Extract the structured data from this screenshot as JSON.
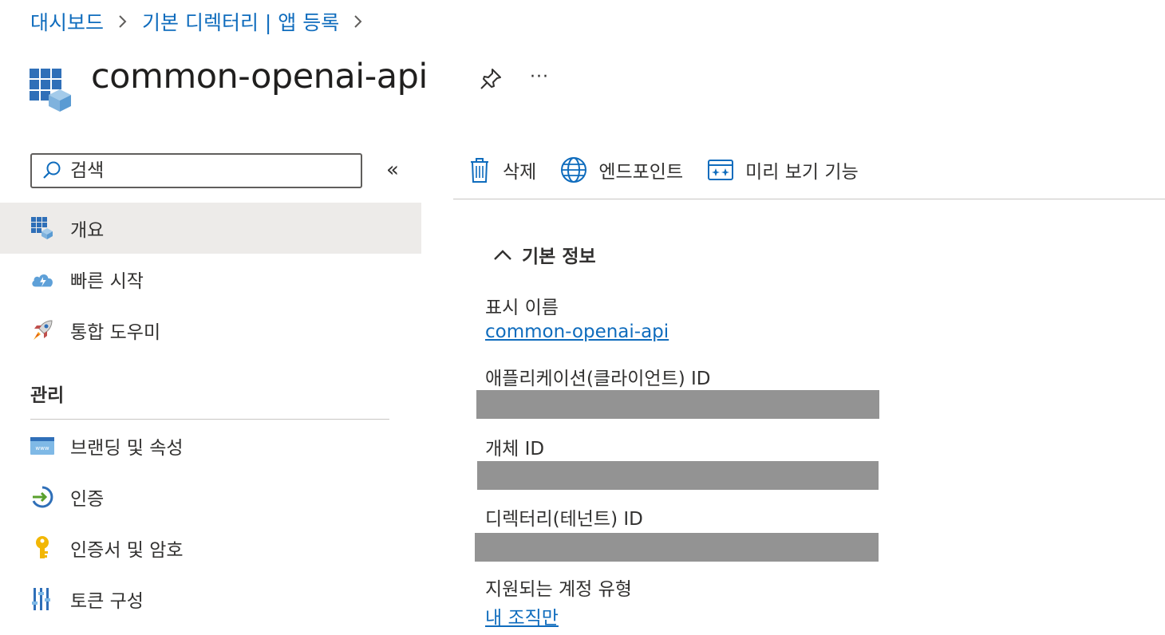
{
  "breadcrumb": {
    "items": [
      "대시보드",
      "기본 디렉터리 | 앱 등록"
    ]
  },
  "header": {
    "title": "common-openai-api",
    "more_label": "···",
    "pin_icon": "pin-icon",
    "app_icon": "app-registration-icon"
  },
  "sidebar": {
    "search_placeholder": "검색",
    "collapse_label": "«",
    "items": [
      {
        "label": "개요",
        "icon": "overview-icon",
        "active": true
      },
      {
        "label": "빠른 시작",
        "icon": "quickstart-cloud-icon"
      },
      {
        "label": "통합 도우미",
        "icon": "rocket-icon"
      }
    ],
    "manage_heading": "관리",
    "manage_items": [
      {
        "label": "브랜딩 및 속성",
        "icon": "www-icon"
      },
      {
        "label": "인증",
        "icon": "authentication-icon"
      },
      {
        "label": "인증서 및 암호",
        "icon": "key-icon"
      },
      {
        "label": "토큰 구성",
        "icon": "token-config-icon"
      }
    ]
  },
  "toolbar": {
    "delete_label": "삭제",
    "endpoints_label": "엔드포인트",
    "preview_label": "미리 보기 기능"
  },
  "essentials": {
    "heading": "기본 정보",
    "display_name_label": "표시 이름",
    "display_name_value": "common-openai-api",
    "app_id_label": "애플리케이션(클라이언트) ID",
    "object_id_label": "개체 ID",
    "tenant_id_label": "디렉터리(테넌트) ID",
    "account_type_label": "지원되는 계정 유형",
    "account_type_value": "내 조직만"
  },
  "colors": {
    "link": "#0f6cbd",
    "redacted": "#939393",
    "active_nav": "#edebe9"
  }
}
